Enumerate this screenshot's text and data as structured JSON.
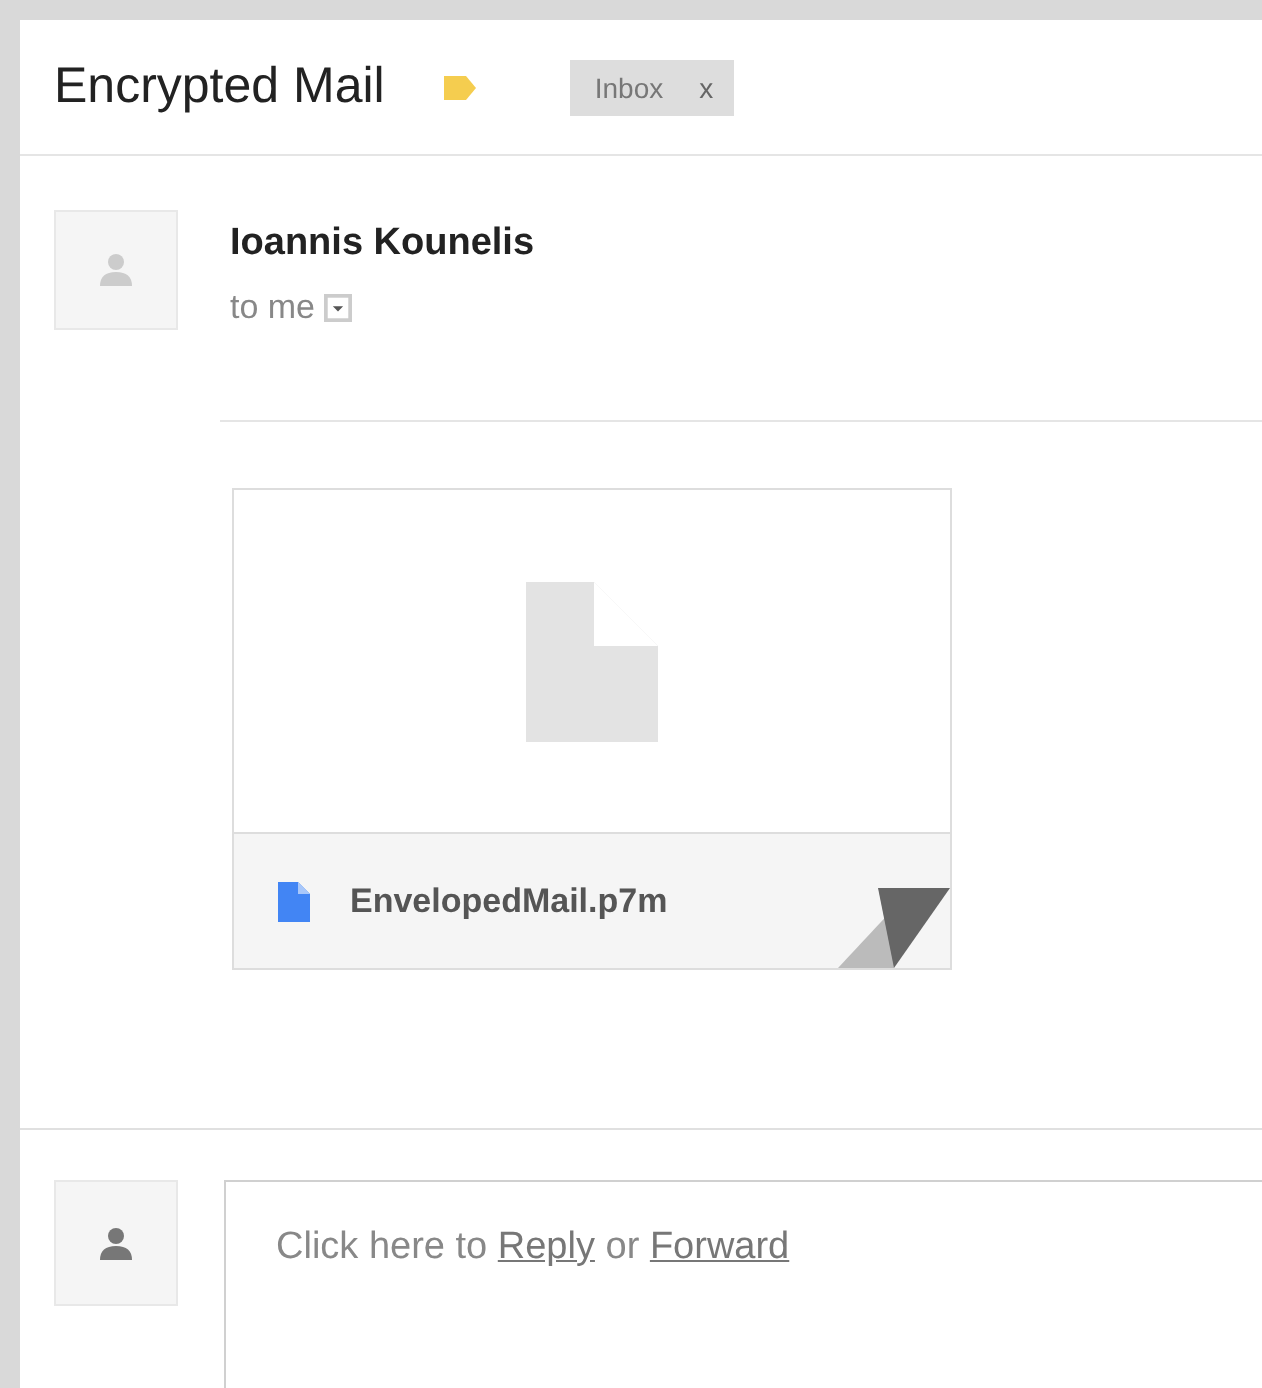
{
  "subject": "Encrypted Mail",
  "labels": [
    {
      "text": "Inbox",
      "remove": "x"
    }
  ],
  "message": {
    "sender": "Ioannis Kounelis",
    "recipient": "to me"
  },
  "attachments": [
    {
      "filename": "EnvelopedMail.p7m"
    }
  ],
  "reply": {
    "parts": [
      {
        "kind": "text",
        "text": "Click here to"
      },
      {
        "kind": "link",
        "text": "Reply"
      },
      {
        "kind": "text",
        "text": "or"
      },
      {
        "kind": "link",
        "text": "Forward"
      }
    ]
  }
}
